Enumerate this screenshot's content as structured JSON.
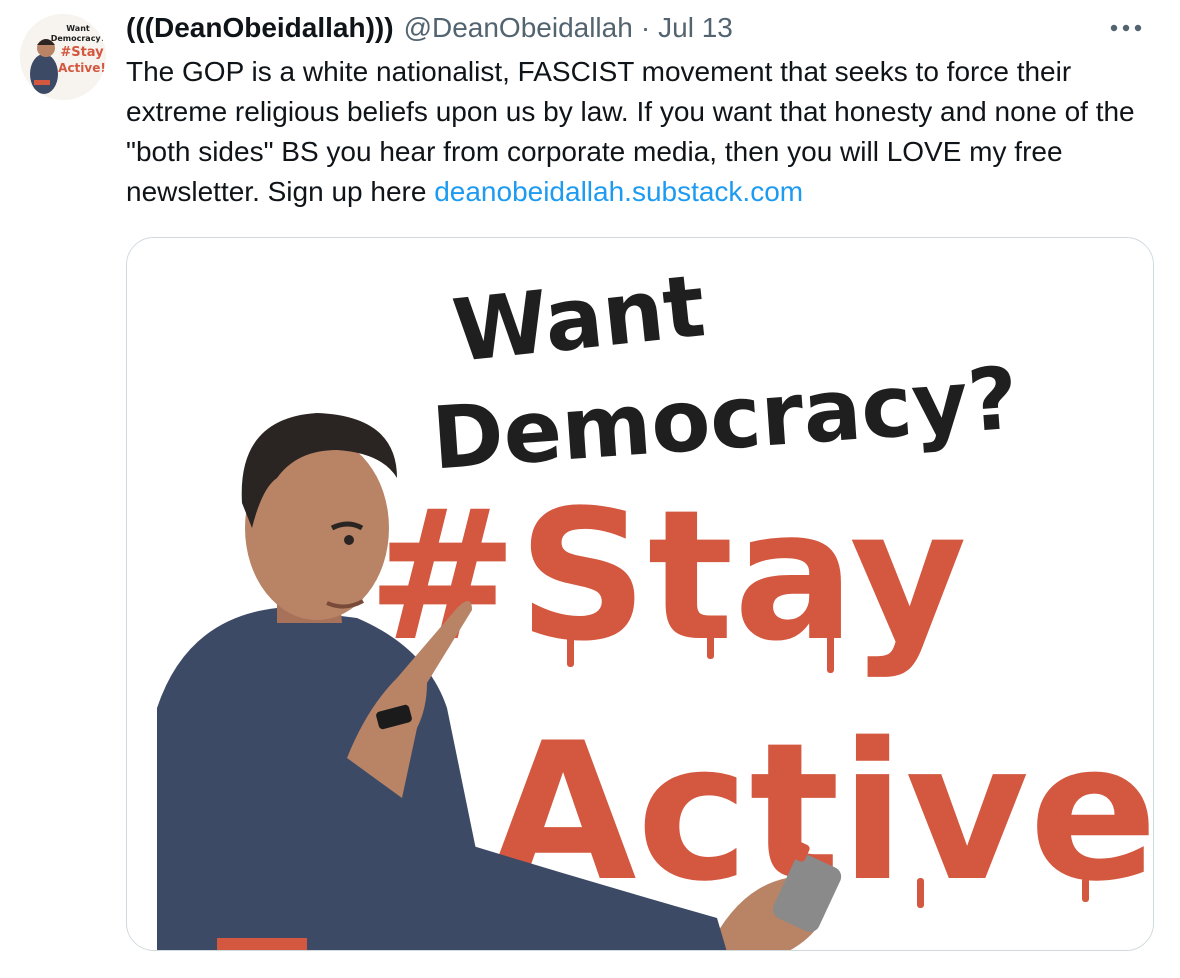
{
  "author": {
    "display_name": "(((DeanObeidallah)))",
    "handle": "@DeanObeidallah",
    "separator": "·",
    "timestamp": "Jul 13",
    "avatar_icon": "profile-avatar-icon"
  },
  "tweet": {
    "text_before_link": "The GOP is a white nationalist, FASCIST movement that seeks to force their extreme religious beliefs upon us by law. If you want that honesty and none of the \"both sides\" BS you hear from corporate media, then you will LOVE my free newsletter. Sign up here ",
    "link_text": "deanobeidallah.substack.com"
  },
  "more_menu_icon": "more-options-icon",
  "media": {
    "lines": {
      "line1": "Want",
      "line2": "Democracy?",
      "line3": "#Stay",
      "line4": "Active!"
    },
    "colors": {
      "black_text": "#1f1f1f",
      "red_text": "#d4573f",
      "shirt": "#3d4a66",
      "skin": "#b98466"
    }
  },
  "colors": {
    "link": "#1d9bf0",
    "secondary_text": "#536471",
    "primary_text": "#0f1419",
    "border": "#cfd9de"
  }
}
